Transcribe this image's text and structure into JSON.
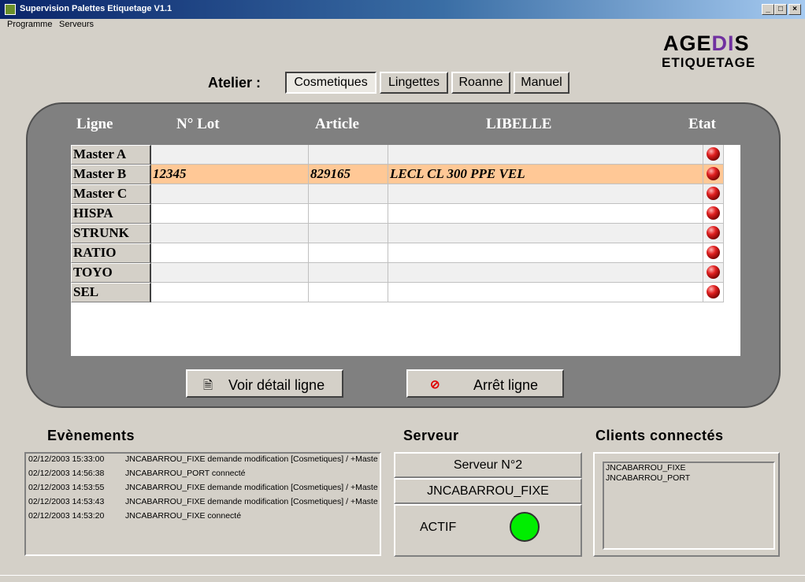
{
  "window": {
    "title": "Supervision Palettes Etiquetage  V1.1",
    "buttons": {
      "minimize": "_",
      "maximize": "□",
      "close": "×"
    }
  },
  "menu": [
    "Programme",
    "Serveurs"
  ],
  "logo": {
    "line1_a": "AGE",
    "line1_b": "DI",
    "line1_c": "S",
    "line2": "ETIQUETAGE"
  },
  "atelier": {
    "label": "Atelier :",
    "tabs": [
      "Cosmetiques",
      "Lingettes",
      "Roanne",
      "Manuel"
    ],
    "selected": "Cosmetiques"
  },
  "table": {
    "columns": {
      "ligne": "Ligne",
      "lot": "N° Lot",
      "article": "Article",
      "libelle": "LIBELLE",
      "etat": "Etat"
    },
    "rows": [
      {
        "ligne": "Master A",
        "lot": "",
        "article": "",
        "libelle": ""
      },
      {
        "ligne": "Master B",
        "lot": "12345",
        "article": "829165",
        "libelle": "LECL CL 300 PPE VEL"
      },
      {
        "ligne": "Master C",
        "lot": "",
        "article": "",
        "libelle": ""
      },
      {
        "ligne": "HISPA",
        "lot": "",
        "article": "",
        "libelle": ""
      },
      {
        "ligne": "STRUNK",
        "lot": "",
        "article": "",
        "libelle": ""
      },
      {
        "ligne": "RATIO",
        "lot": "",
        "article": "",
        "libelle": ""
      },
      {
        "ligne": "TOYO",
        "lot": "",
        "article": "",
        "libelle": ""
      },
      {
        "ligne": "SEL",
        "lot": "",
        "article": "",
        "libelle": ""
      }
    ],
    "selected_row_color": "#ffc896",
    "led_color": "#e02020"
  },
  "buttons": {
    "detail": {
      "label": "Voir détail ligne",
      "icon": "document-icon"
    },
    "stop": {
      "label": "Arrêt ligne",
      "icon": "stop-icon"
    }
  },
  "events": {
    "title": "Evènements",
    "items": [
      {
        "date": "02/12/2003 15:33:00",
        "msg": "JNCABARROU_FIXE demande modification [Cosmetiques] / +Maste"
      },
      {
        "date": "02/12/2003 14:56:38",
        "msg": "JNCABARROU_PORT connecté"
      },
      {
        "date": "02/12/2003 14:53:55",
        "msg": "JNCABARROU_FIXE demande modification [Cosmetiques] / +Maste"
      },
      {
        "date": "02/12/2003 14:53:43",
        "msg": "JNCABARROU_FIXE demande modification [Cosmetiques] / +Maste"
      },
      {
        "date": "02/12/2003 14:53:20",
        "msg": "JNCABARROU_FIXE connecté"
      }
    ]
  },
  "server": {
    "title": "Serveur",
    "name": "Serveur N°2",
    "host": "JNCABARROU_FIXE",
    "status": "ACTIF",
    "status_color": "#00ee00"
  },
  "clients": {
    "title": "Clients connectés",
    "items": [
      "JNCABARROU_FIXE",
      "JNCABARROU_PORT"
    ]
  }
}
